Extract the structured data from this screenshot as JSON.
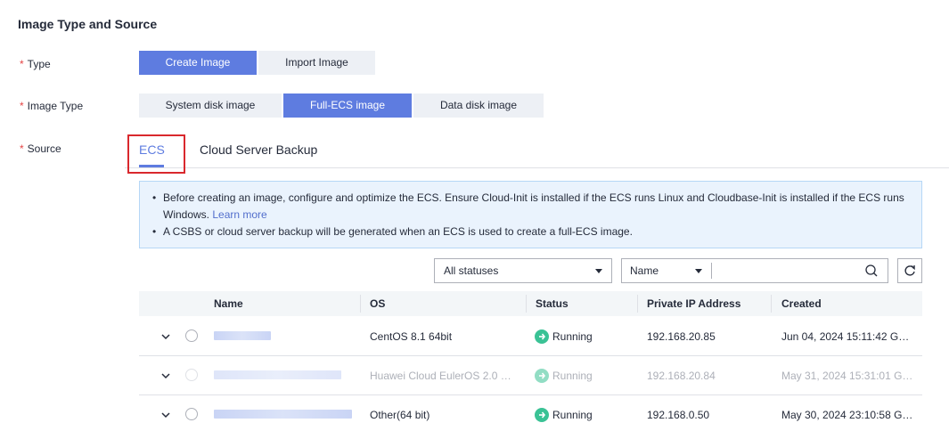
{
  "section": {
    "title": "Image Type and Source"
  },
  "form": {
    "type_label": "Type",
    "image_type_label": "Image Type",
    "source_label": "Source",
    "required_mark": "*"
  },
  "type_options": [
    "Create Image",
    "Import Image"
  ],
  "type_selected": "Create Image",
  "image_type_options": [
    "System disk image",
    "Full-ECS image",
    "Data disk image"
  ],
  "image_type_selected": "Full-ECS image",
  "source_tabs": [
    "ECS",
    "Cloud Server Backup"
  ],
  "source_selected": "ECS",
  "info": {
    "line1": "Before creating an image, configure and optimize the ECS. Ensure Cloud-Init is installed if the ECS runs Linux and Cloudbase-Init is installed if the ECS runs Windows.",
    "learn_more": "Learn more",
    "line2": "A CSBS or cloud server backup will be generated when an ECS is used to create a full-ECS image."
  },
  "filters": {
    "status_select": "All statuses",
    "field_select": "Name",
    "search_placeholder": ""
  },
  "table": {
    "columns": [
      "Name",
      "OS",
      "Status",
      "Private IP Address",
      "Created"
    ],
    "rows": [
      {
        "os": "CentOS 8.1 64bit",
        "status": "Running",
        "ip": "192.168.20.85",
        "created": "Jun 04, 2024 15:11:42 G…",
        "disabled": false
      },
      {
        "os": "Huawei Cloud EulerOS 2.0 …",
        "status": "Running",
        "ip": "192.168.20.84",
        "created": "May 31, 2024 15:31:01 G…",
        "disabled": true
      },
      {
        "os": "Other(64 bit)",
        "status": "Running",
        "ip": "192.168.0.50",
        "created": "May 30, 2024 23:10:58 G…",
        "disabled": false
      }
    ]
  },
  "colors": {
    "accent": "#5e7ce0",
    "running": "#3ac295",
    "required": "#e54545",
    "highlight": "#d9282d"
  }
}
